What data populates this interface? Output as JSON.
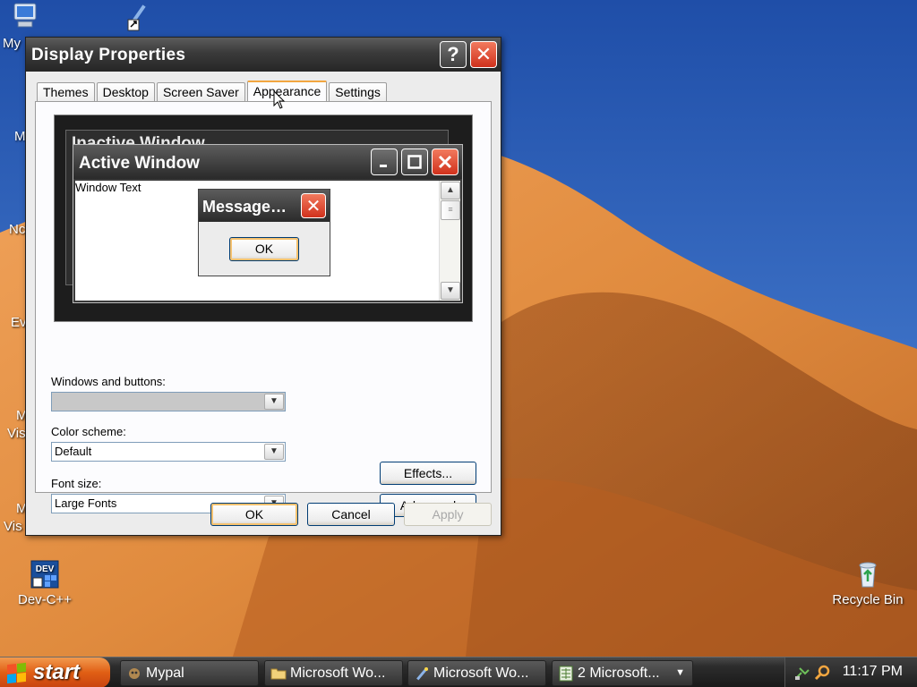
{
  "desktop": {
    "icons": [
      {
        "label": "My",
        "icon": "computer-icon"
      },
      {
        "label": "",
        "icon": "wizard-shortcut-icon"
      },
      {
        "label": "Dev-C++",
        "icon": "devcpp-icon"
      },
      {
        "label": "Recycle Bin",
        "icon": "recycle-bin-icon"
      }
    ],
    "partial_labels": [
      "M",
      "Nc",
      "Ev",
      "M",
      "Vis",
      "M",
      "Vis"
    ]
  },
  "dialog": {
    "title": "Display Properties",
    "help_glyph": "?",
    "close_glyph": "✕",
    "tabs": [
      {
        "label": "Themes"
      },
      {
        "label": "Desktop"
      },
      {
        "label": "Screen Saver"
      },
      {
        "label": "Appearance",
        "active": true
      },
      {
        "label": "Settings"
      }
    ],
    "preview": {
      "inactive_title": "Inactive Window",
      "active_title": "Active Window",
      "window_text": "Window Text",
      "message_title": "Message…",
      "message_ok": "OK"
    },
    "form": {
      "windows_buttons_label": "Windows and buttons:",
      "windows_buttons_value": "",
      "color_scheme_label": "Color scheme:",
      "color_scheme_value": "Default",
      "font_size_label": "Font size:",
      "font_size_value": "Large Fonts",
      "effects_label": "Effects...",
      "advanced_label": "Advanced"
    },
    "buttons": {
      "ok": "OK",
      "cancel": "Cancel",
      "apply": "Apply"
    }
  },
  "taskbar": {
    "start_label": "start",
    "tasks": [
      {
        "label": "Mypal",
        "icon": "mypal-icon"
      },
      {
        "label": "Microsoft Wo...",
        "icon": "folder-icon"
      },
      {
        "label": "Microsoft Wo...",
        "icon": "wizard-icon"
      },
      {
        "label": "2 Microsoft...",
        "icon": "spreadsheet-icon",
        "dropdown": "▼"
      }
    ],
    "clock": "11:17 PM"
  },
  "colors": {
    "title_bar": "#3a3a3a",
    "close_red": "#d0311c",
    "start_orange": "#e05e14",
    "active_tab": "#f2a640"
  }
}
